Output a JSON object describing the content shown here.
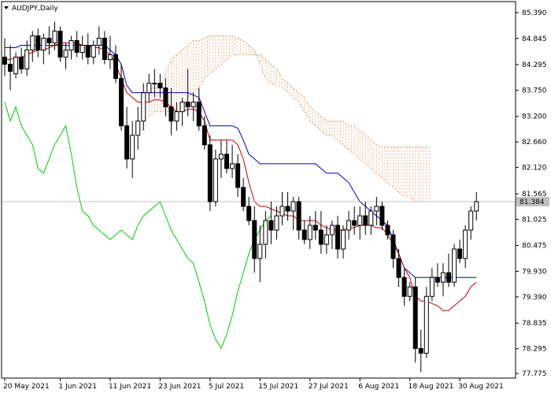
{
  "window": {
    "symbol_label": "AUDJPY,Daily",
    "dropdown_icon": "triangle-down-icon"
  },
  "chart_data": {
    "type": "candlestick",
    "title": "AUDJPY,Daily",
    "indicator": "Ichimoku Kinko Hyo",
    "grid": false,
    "ylim": [
      77.775,
      85.39
    ],
    "y_ticks": [
      "85.390",
      "84.845",
      "84.295",
      "83.750",
      "83.200",
      "82.660",
      "82.120",
      "81.565",
      "81.025",
      "80.475",
      "79.930",
      "79.390",
      "78.835",
      "78.295",
      "77.775"
    ],
    "x_labels": [
      "20 May 2021",
      "1 Jun 2021",
      "11 Jun 2021",
      "23 Jun 2021",
      "5 Jul 2021",
      "15 Jul 2021",
      "27 Jul 2021",
      "6 Aug 2021",
      "18 Aug 2021",
      "30 Aug 2021"
    ],
    "x_label_index": [
      0,
      10,
      19,
      28,
      37,
      46,
      55,
      64,
      73,
      82
    ],
    "current_price": "81.384",
    "colors": {
      "up_candle": "#ffffff",
      "down_candle": "#000000",
      "tenkan": "#cc0000",
      "kijun": "#0000cc",
      "chikou": "#00cc00",
      "kumo": "#e8a070",
      "price_line": "#c0c0c0"
    },
    "candles": [
      [
        84.45,
        84.85,
        84.05,
        84.3
      ],
      [
        84.3,
        84.7,
        83.75,
        84.15
      ],
      [
        84.1,
        84.55,
        84.0,
        84.45
      ],
      [
        84.45,
        84.65,
        84.1,
        84.2
      ],
      [
        84.2,
        84.8,
        84.05,
        84.6
      ],
      [
        84.6,
        85.0,
        84.35,
        84.9
      ],
      [
        84.9,
        85.05,
        84.45,
        84.6
      ],
      [
        84.6,
        84.95,
        84.3,
        84.85
      ],
      [
        84.85,
        85.1,
        84.5,
        84.75
      ],
      [
        84.75,
        85.2,
        84.6,
        85.0
      ],
      [
        85.0,
        85.1,
        84.35,
        84.45
      ],
      [
        84.45,
        84.75,
        84.2,
        84.6
      ],
      [
        84.6,
        84.9,
        84.4,
        84.8
      ],
      [
        84.8,
        85.0,
        84.45,
        84.55
      ],
      [
        84.55,
        84.9,
        84.4,
        84.7
      ],
      [
        84.7,
        84.95,
        84.3,
        84.45
      ],
      [
        84.45,
        84.8,
        84.3,
        84.7
      ],
      [
        84.7,
        85.1,
        84.5,
        84.85
      ],
      [
        84.85,
        85.0,
        84.3,
        84.4
      ],
      [
        84.4,
        84.9,
        84.2,
        84.5
      ],
      [
        84.5,
        84.7,
        83.9,
        84.0
      ],
      [
        84.0,
        84.3,
        82.9,
        83.0
      ],
      [
        83.0,
        83.4,
        82.1,
        82.3
      ],
      [
        82.3,
        83.1,
        81.9,
        82.8
      ],
      [
        82.8,
        83.4,
        82.5,
        83.1
      ],
      [
        83.1,
        83.9,
        82.9,
        83.7
      ],
      [
        83.7,
        84.1,
        83.5,
        83.9
      ],
      [
        83.9,
        84.2,
        83.6,
        83.9
      ],
      [
        83.9,
        84.1,
        83.6,
        83.8
      ],
      [
        83.8,
        84.0,
        83.2,
        83.4
      ],
      [
        83.4,
        83.8,
        82.8,
        83.1
      ],
      [
        83.1,
        83.5,
        82.9,
        83.3
      ],
      [
        83.3,
        83.6,
        83.0,
        83.5
      ],
      [
        83.5,
        84.2,
        83.2,
        83.4
      ],
      [
        83.4,
        83.7,
        83.1,
        83.5
      ],
      [
        83.5,
        83.8,
        82.9,
        83.0
      ],
      [
        83.0,
        83.2,
        82.5,
        82.6
      ],
      [
        82.6,
        82.8,
        81.2,
        81.4
      ],
      [
        81.4,
        82.5,
        81.3,
        82.3
      ],
      [
        82.3,
        82.7,
        81.9,
        82.4
      ],
      [
        82.4,
        82.7,
        82.0,
        82.1
      ],
      [
        82.1,
        82.6,
        81.9,
        82.2
      ],
      [
        82.2,
        82.4,
        81.5,
        81.7
      ],
      [
        81.7,
        81.9,
        81.2,
        81.3
      ],
      [
        81.3,
        81.5,
        80.9,
        81.0
      ],
      [
        81.0,
        81.3,
        79.9,
        80.2
      ],
      [
        80.2,
        80.9,
        79.7,
        80.5
      ],
      [
        80.5,
        81.2,
        80.2,
        81.0
      ],
      [
        81.0,
        81.4,
        80.5,
        80.8
      ],
      [
        80.8,
        81.3,
        80.6,
        81.1
      ],
      [
        81.1,
        81.6,
        80.9,
        81.3
      ],
      [
        81.3,
        81.6,
        81.0,
        81.2
      ],
      [
        81.2,
        81.5,
        80.8,
        81.4
      ],
      [
        81.4,
        81.5,
        80.6,
        80.8
      ],
      [
        80.8,
        81.0,
        80.5,
        80.6
      ],
      [
        80.6,
        81.1,
        80.4,
        80.9
      ],
      [
        80.9,
        81.2,
        80.6,
        80.8
      ],
      [
        80.8,
        81.2,
        80.3,
        80.5
      ],
      [
        80.5,
        80.9,
        80.3,
        80.7
      ],
      [
        80.7,
        81.0,
        80.4,
        80.9
      ],
      [
        80.9,
        81.1,
        80.2,
        80.4
      ],
      [
        80.4,
        80.9,
        80.2,
        80.8
      ],
      [
        80.8,
        81.2,
        80.6,
        81.0
      ],
      [
        81.0,
        81.3,
        80.7,
        80.9
      ],
      [
        80.9,
        81.3,
        80.6,
        81.1
      ],
      [
        81.1,
        81.4,
        80.7,
        80.9
      ],
      [
        80.9,
        81.3,
        80.7,
        81.2
      ],
      [
        81.2,
        81.5,
        80.9,
        81.3
      ],
      [
        81.3,
        81.4,
        80.8,
        80.9
      ],
      [
        80.9,
        81.0,
        80.6,
        80.7
      ],
      [
        80.7,
        80.8,
        80.0,
        80.2
      ],
      [
        80.2,
        80.4,
        79.6,
        79.8
      ],
      [
        79.8,
        80.0,
        79.2,
        79.4
      ],
      [
        79.4,
        79.7,
        79.3,
        79.6
      ],
      [
        79.6,
        79.8,
        78.0,
        78.3
      ],
      [
        78.3,
        78.7,
        77.8,
        78.2
      ],
      [
        78.2,
        79.6,
        78.1,
        79.4
      ],
      [
        79.4,
        80.0,
        79.3,
        79.8
      ],
      [
        79.8,
        80.1,
        79.6,
        79.7
      ],
      [
        79.7,
        80.1,
        79.4,
        79.9
      ],
      [
        79.9,
        80.3,
        79.6,
        79.7
      ],
      [
        79.7,
        80.5,
        79.6,
        80.4
      ],
      [
        80.4,
        80.6,
        80.1,
        80.2
      ],
      [
        80.2,
        80.9,
        80.0,
        80.8
      ],
      [
        80.8,
        81.3,
        80.6,
        81.2
      ],
      [
        81.2,
        81.6,
        81.0,
        81.4
      ]
    ],
    "tenkan": [
      84.4,
      84.4,
      84.45,
      84.45,
      84.5,
      84.55,
      84.6,
      84.6,
      84.65,
      84.7,
      84.75,
      84.75,
      84.75,
      84.75,
      84.7,
      84.7,
      84.65,
      84.65,
      84.6,
      84.5,
      84.3,
      84.0,
      83.7,
      83.6,
      83.5,
      83.5,
      83.5,
      83.55,
      83.55,
      83.5,
      83.4,
      83.3,
      83.3,
      83.35,
      83.35,
      83.3,
      83.1,
      82.7,
      82.7,
      82.7,
      82.7,
      82.7,
      82.6,
      82.3,
      81.8,
      81.4,
      81.3,
      81.3,
      81.25,
      81.2,
      81.15,
      81.1,
      81.1,
      81.0,
      81.0,
      81.0,
      81.0,
      80.9,
      80.85,
      80.8,
      80.8,
      80.8,
      80.85,
      80.85,
      80.9,
      80.9,
      80.9,
      80.85,
      80.85,
      80.7,
      80.5,
      80.3,
      80.0,
      79.8,
      79.4,
      79.3,
      79.3,
      79.25,
      79.2,
      79.1,
      79.1,
      79.2,
      79.3,
      79.4,
      79.6,
      79.7
    ],
    "kijun": [
      84.65,
      84.65,
      84.65,
      84.7,
      84.7,
      84.7,
      84.7,
      84.7,
      84.7,
      84.7,
      84.7,
      84.7,
      84.7,
      84.7,
      84.7,
      84.7,
      84.7,
      84.7,
      84.7,
      84.6,
      84.5,
      84.3,
      83.85,
      83.7,
      83.7,
      83.7,
      83.7,
      83.7,
      83.7,
      83.7,
      83.7,
      83.7,
      83.7,
      83.7,
      83.65,
      83.6,
      83.3,
      83.0,
      83.0,
      83.0,
      83.0,
      83.0,
      82.95,
      82.7,
      82.4,
      82.3,
      82.2,
      82.2,
      82.2,
      82.2,
      82.2,
      82.2,
      82.2,
      82.2,
      82.2,
      82.2,
      82.2,
      82.1,
      82.0,
      82.0,
      82.0,
      81.9,
      81.8,
      81.6,
      81.4,
      81.3,
      81.2,
      81.1,
      81.0,
      80.9,
      80.6,
      80.3,
      80.0,
      79.9,
      79.8,
      79.8,
      79.8,
      79.8,
      79.8,
      79.8,
      79.8,
      79.8,
      79.8,
      79.8,
      79.8,
      79.8
    ],
    "chikou": [
      83.5,
      83.1,
      83.4,
      83.0,
      82.8,
      82.6,
      82.1,
      82.0,
      82.3,
      82.6,
      82.8,
      83.0,
      82.4,
      81.7,
      81.2,
      81.1,
      80.9,
      80.8,
      80.7,
      80.6,
      80.7,
      80.8,
      80.7,
      80.6,
      80.9,
      81.1,
      81.2,
      81.3,
      81.4,
      81.1,
      80.8,
      80.6,
      80.4,
      80.2,
      80.1,
      79.7,
      79.3,
      78.8,
      78.5,
      78.3,
      78.6,
      79.0,
      79.5,
      79.9,
      80.3,
      80.6,
      80.8,
      81.0,
      81.1
    ],
    "span_a": [
      83.8,
      83.8,
      83.8,
      84.1,
      84.4,
      84.5,
      84.6,
      84.7,
      84.8,
      84.8,
      84.85,
      84.9,
      84.9,
      84.9,
      84.9,
      84.9,
      84.85,
      84.8,
      84.7,
      84.6,
      84.3,
      84.0,
      83.9,
      83.85,
      83.8,
      83.7,
      83.6,
      83.5,
      83.3,
      83.1,
      83.0,
      82.9,
      82.8,
      82.8,
      82.7,
      82.6,
      82.5,
      82.4,
      82.3,
      82.2,
      82.1,
      82.0,
      81.9,
      81.8,
      81.7,
      81.6,
      81.5,
      81.5,
      81.4,
      81.4,
      81.4
    ],
    "span_b": [
      83.2,
      83.3,
      83.3,
      83.3,
      83.3,
      83.3,
      83.4,
      83.6,
      83.7,
      83.8,
      84.0,
      84.1,
      84.2,
      84.3,
      84.4,
      84.5,
      84.5,
      84.5,
      84.5,
      84.5,
      84.5,
      84.4,
      84.3,
      84.2,
      84.0,
      83.9,
      83.8,
      83.7,
      83.6,
      83.4,
      83.3,
      83.2,
      83.1,
      83.1,
      83.1,
      83.1,
      83.0,
      83.0,
      82.9,
      82.8,
      82.7,
      82.6,
      82.55,
      82.55,
      82.55,
      82.55,
      82.55,
      82.55,
      82.55,
      82.55,
      82.55
    ]
  }
}
